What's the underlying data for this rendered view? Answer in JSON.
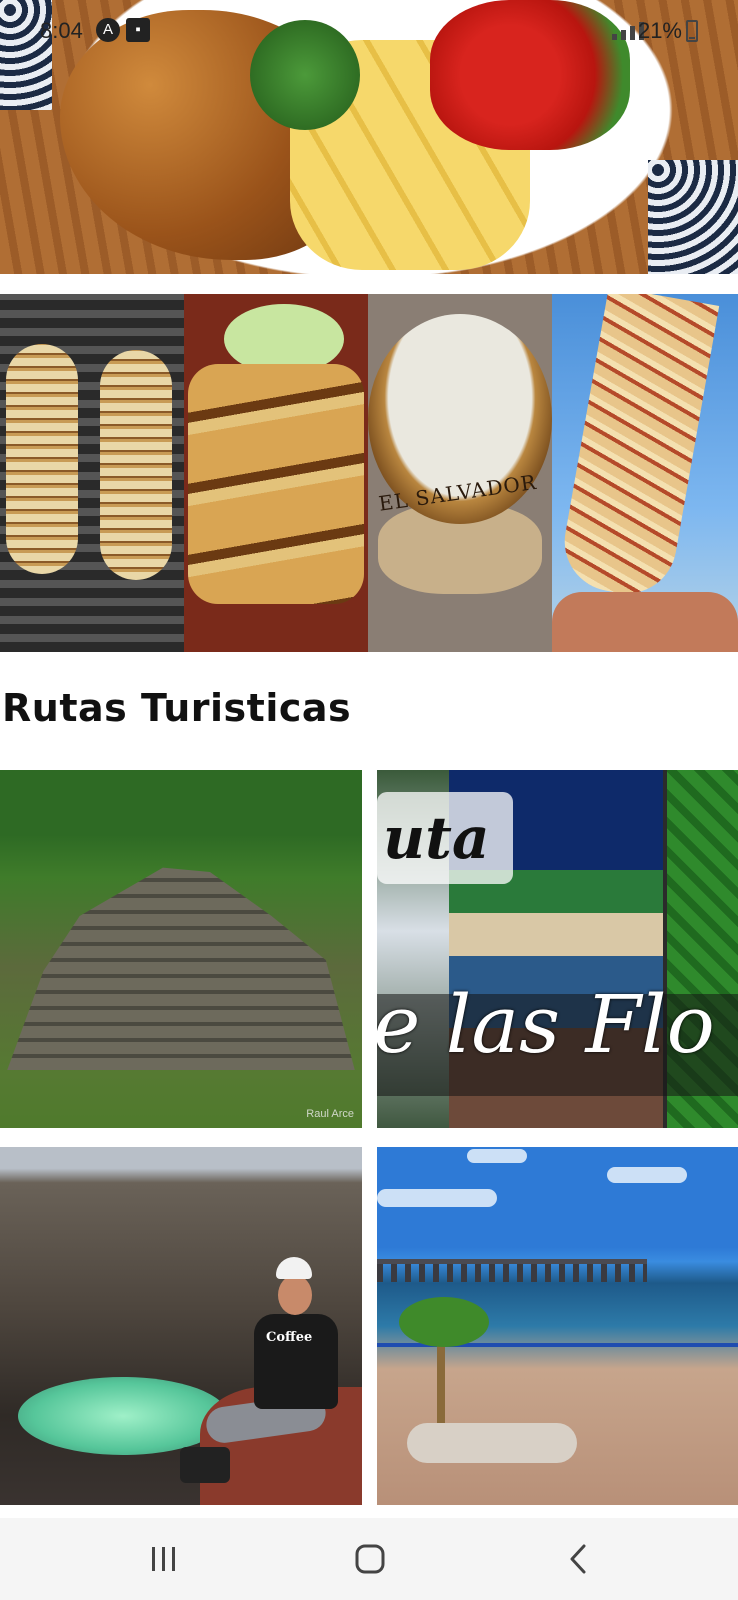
{
  "status_bar": {
    "time": "8:04",
    "battery_text": "21%",
    "icons": [
      "a-circle-icon",
      "photo-icon",
      "signal-icon",
      "battery-icon"
    ]
  },
  "hero_image": {
    "subject": "food-dish"
  },
  "food_strip": {
    "tiles": [
      {
        "name": "elote-asado"
      },
      {
        "name": "tortillas"
      },
      {
        "name": "atole",
        "bowl_text": "EL SALVADOR"
      },
      {
        "name": "elote-loco"
      }
    ]
  },
  "section": {
    "title": "Rutas Turisticas"
  },
  "routes": [
    {
      "name": "ruinas",
      "credit": "Raul Arce"
    },
    {
      "name": "ruta-de-las-flores",
      "word1": "uta",
      "word2": "e las Flo"
    },
    {
      "name": "volcan",
      "shirt_text": "Coffee"
    },
    {
      "name": "playa"
    }
  ],
  "nav_bar": {
    "icons": [
      "recents-icon",
      "home-icon",
      "back-icon"
    ]
  },
  "colors": {
    "background": "#ffffff",
    "nav_background": "#f5f5f5",
    "nav_icon": "#444444"
  }
}
